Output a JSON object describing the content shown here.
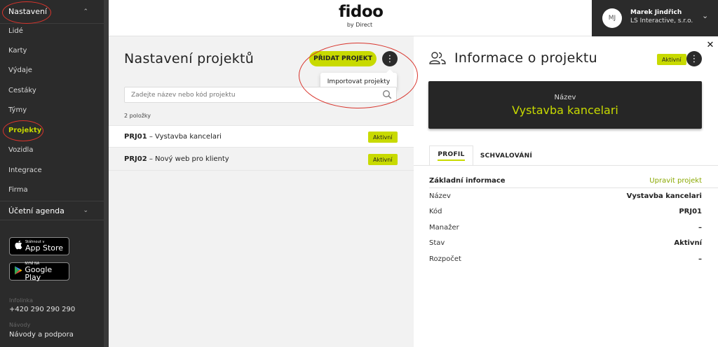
{
  "sidebar": {
    "section": "Nastavení",
    "items": [
      {
        "label": "Lidé"
      },
      {
        "label": "Karty"
      },
      {
        "label": "Výdaje"
      },
      {
        "label": "Cestáky"
      },
      {
        "label": "Týmy"
      },
      {
        "label": "Projekty",
        "active": true
      },
      {
        "label": "Vozidla"
      },
      {
        "label": "Integrace"
      },
      {
        "label": "Firma"
      }
    ],
    "accounting": "Účetní agenda",
    "app_store": {
      "small": "Stáhnout v",
      "big": "App Store",
      "icon": "apple-icon"
    },
    "google_play": {
      "small": "NYNÍ NA",
      "big": "Google Play",
      "icon": "play-icon"
    },
    "infolinka_label": "Infolinka",
    "infolinka_value": "+420 290 290 290",
    "navody_label": "Návody",
    "navody_value": "Návody a podpora"
  },
  "header": {
    "logo_main_a": "fid",
    "logo_main_b": "oo",
    "logo_sub": "by Direct",
    "user": {
      "initials": "MJ",
      "name": "Marek Jindřich",
      "company": "LS Interactive, s.r.o."
    }
  },
  "projects": {
    "title": "Nastavení projektů",
    "add_button": "PŘIDAT PROJEKT",
    "menu_item": "Importovat projekty",
    "search_placeholder": "Zadejte název nebo kód projektu",
    "count": "2 položky",
    "rows": [
      {
        "code": "PRJ01",
        "name": " – Vystavba kancelari",
        "status": "Aktivní"
      },
      {
        "code": "PRJ02",
        "name": " – Nový web pro klienty",
        "status": "Aktivní"
      }
    ]
  },
  "detail": {
    "title": "Informace o projektu",
    "status": "Aktivní",
    "hero_label": "Název",
    "hero_value": "Vystavba kancelari",
    "tabs": [
      "PROFIL",
      "SCHVALOVÁNÍ"
    ],
    "section_title": "Základní informace",
    "edit_link": "Upravit projekt",
    "fields": [
      {
        "label": "Název",
        "value": "Vystavba kancelari"
      },
      {
        "label": "Kód",
        "value": "PRJ01"
      },
      {
        "label": "Manažer",
        "value": "–"
      },
      {
        "label": "Stav",
        "value": "Aktivní"
      },
      {
        "label": "Rozpočet",
        "value": "–"
      }
    ]
  },
  "colors": {
    "accent": "#c8da00",
    "sidebar": "#2b2b2b",
    "annotation": "#d8342c"
  }
}
